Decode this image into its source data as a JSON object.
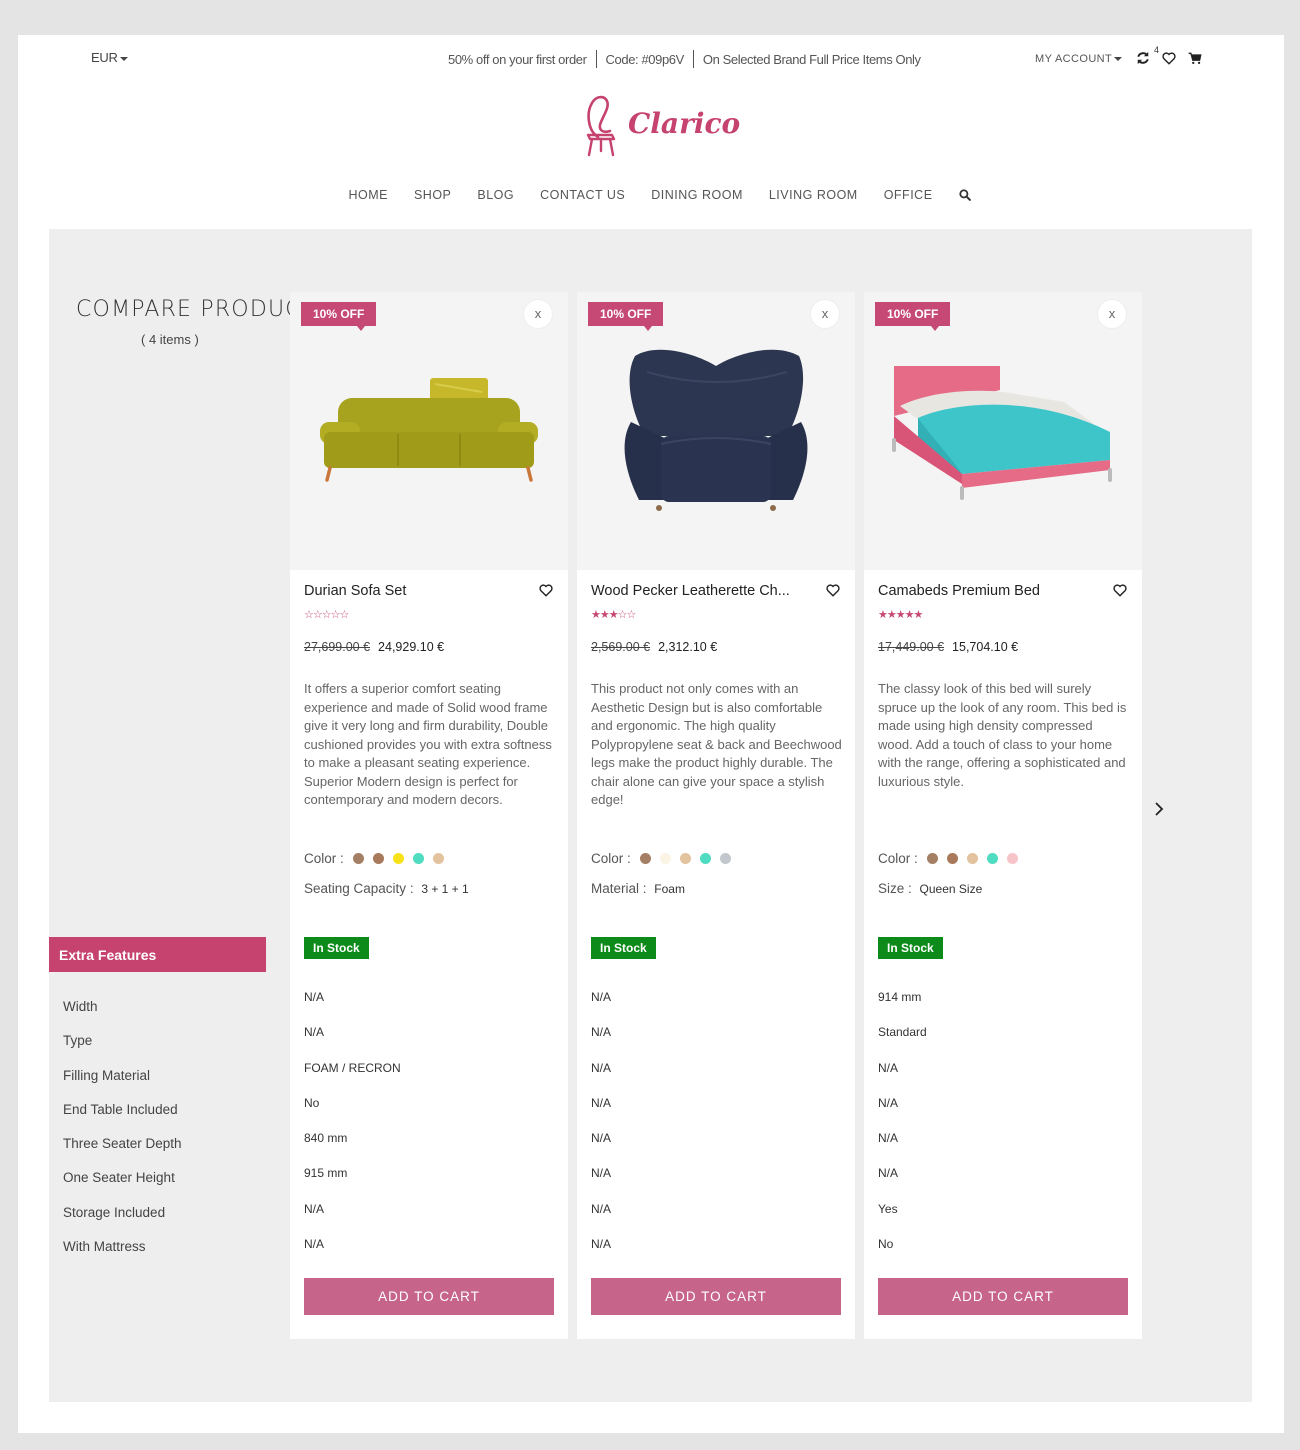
{
  "topbar": {
    "currency": "EUR",
    "promo": [
      "50% off on your first order",
      "Code: #09p6V",
      "On Selected Brand Full Price Items Only"
    ],
    "account_label": "MY ACCOUNT",
    "compare_count": "4"
  },
  "brand": {
    "name": "Clarico",
    "color": "#c6426f"
  },
  "nav": [
    "HOME",
    "SHOP",
    "BLOG",
    "CONTACT US",
    "DINING ROOM",
    "LIVING ROOM",
    "OFFICE"
  ],
  "compare": {
    "title": "COMPARE PRODUCT",
    "count": "( 4 items )",
    "features_heading": "Extra Features",
    "feature_labels": [
      "Width",
      "Type",
      "Filling Material",
      "End Table Included",
      "Three Seater Depth",
      "One Seater Height",
      "Storage Included",
      "With Mattress"
    ]
  },
  "products": [
    {
      "discount": "10% OFF",
      "close": "x",
      "name": "Durian Sofa Set",
      "rating": 0,
      "stars": "☆☆☆☆☆",
      "old_price": "27,699.00 €",
      "price": "24,929.10 €",
      "description": "It offers a superior comfort seating experience and made of Solid wood frame give it very long and firm durability, Double cushioned provides you with extra softness to make a pleasant seating experience. Superior Modern design is perfect for contemporary and modern decors.",
      "color_label": "Color :",
      "colors": [
        "#a47f64",
        "#a8795a",
        "#f7e21a",
        "#4fdcc0",
        "#e3c29e"
      ],
      "attr_label": "Seating Capacity",
      "attr_value": "3 + 1 + 1",
      "stock": "In Stock",
      "features": [
        "N/A",
        "N/A",
        "FOAM / RECRON",
        "No",
        "840 mm",
        "915 mm",
        "N/A",
        "N/A"
      ],
      "cart": "ADD TO CART",
      "image": "sofa"
    },
    {
      "discount": "10% OFF",
      "close": "x",
      "name": "Wood Pecker Leatherette Ch...",
      "rating": 3,
      "stars": "★★★☆☆",
      "old_price": "2,569.00 €",
      "price": "2,312.10 €",
      "description": "This product not only comes with an Aesthetic Design but is also comfortable and ergonomic. The high quality Polypropylene seat & back and Beechwood legs make the product highly durable. The chair alone can give your space a stylish edge!",
      "color_label": "Color :",
      "colors": [
        "#a47f64",
        "#fbf4e4",
        "#e3c29e",
        "#4fdcc0",
        "#c1c7cc"
      ],
      "attr_label": "Material",
      "attr_value": "Foam",
      "stock": "In Stock",
      "features": [
        "N/A",
        "N/A",
        "N/A",
        "N/A",
        "N/A",
        "N/A",
        "N/A",
        "N/A"
      ],
      "cart": "ADD TO CART",
      "image": "armchair"
    },
    {
      "discount": "10% OFF",
      "close": "x",
      "name": "Camabeds Premium Bed",
      "rating": 5,
      "stars": "★★★★★",
      "old_price": "17,449.00 €",
      "price": "15,704.10 €",
      "description": "The classy look of this bed will surely spruce up the look of any room. This bed is made using high density compressed wood. Add a touch of class to your home with the range, offering a sophisticated and luxurious style.",
      "color_label": "Color :",
      "colors": [
        "#a47f64",
        "#a8795a",
        "#e3c29e",
        "#4fdcc0",
        "#f7c4c8"
      ],
      "attr_label": "Size",
      "attr_value": "Queen Size",
      "stock": "In Stock",
      "features": [
        "914 mm",
        "Standard",
        "N/A",
        "N/A",
        "N/A",
        "N/A",
        "Yes",
        "No"
      ],
      "cart": "ADD TO CART",
      "image": "bed"
    }
  ]
}
